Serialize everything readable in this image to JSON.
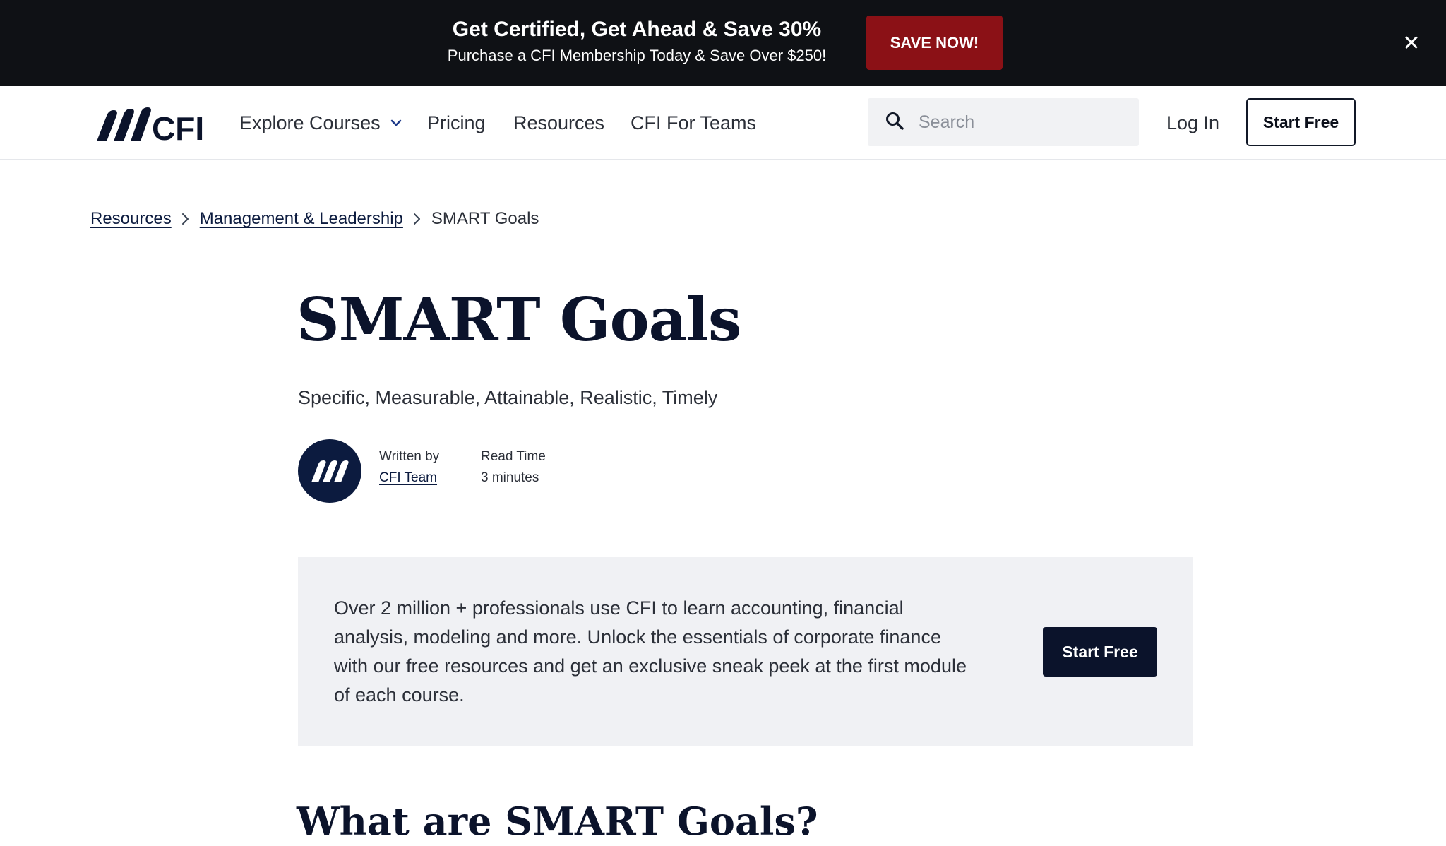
{
  "promo": {
    "headline": "Get Certified, Get Ahead & Save 30%",
    "subline": "Purchase a CFI Membership Today & Save Over $250!",
    "cta_label": "SAVE NOW!",
    "close_icon": "close-icon",
    "background": "#0f1115",
    "cta_color": "#8b1116"
  },
  "nav": {
    "logo_text": "CFI",
    "links": {
      "explore": "Explore Courses",
      "pricing": "Pricing",
      "resources": "Resources",
      "teams": "CFI For Teams"
    },
    "search_placeholder": "Search",
    "login_label": "Log In",
    "start_label": "Start Free"
  },
  "breadcrumb": {
    "items": [
      "Resources",
      "Management & Leadership"
    ],
    "current": "SMART Goals"
  },
  "article": {
    "title": "SMART Goals",
    "subtitle": "Specific, Measurable, Attainable, Realistic, Timely",
    "written_by_label": "Written by",
    "author": "CFI Team",
    "read_time_label": "Read Time",
    "read_time": "3 minutes",
    "next_heading": "What are SMART Goals?"
  },
  "cta": {
    "text": "Over 2 million + professionals use CFI to learn accounting, financial analysis, modeling and more. Unlock the essentials of corporate finance with our free resources and get an exclusive sneak peek at the first module of each course.",
    "button_label": "Start Free"
  },
  "colors": {
    "brand_navy": "#0b132b",
    "cta_background": "#f0f1f4"
  }
}
